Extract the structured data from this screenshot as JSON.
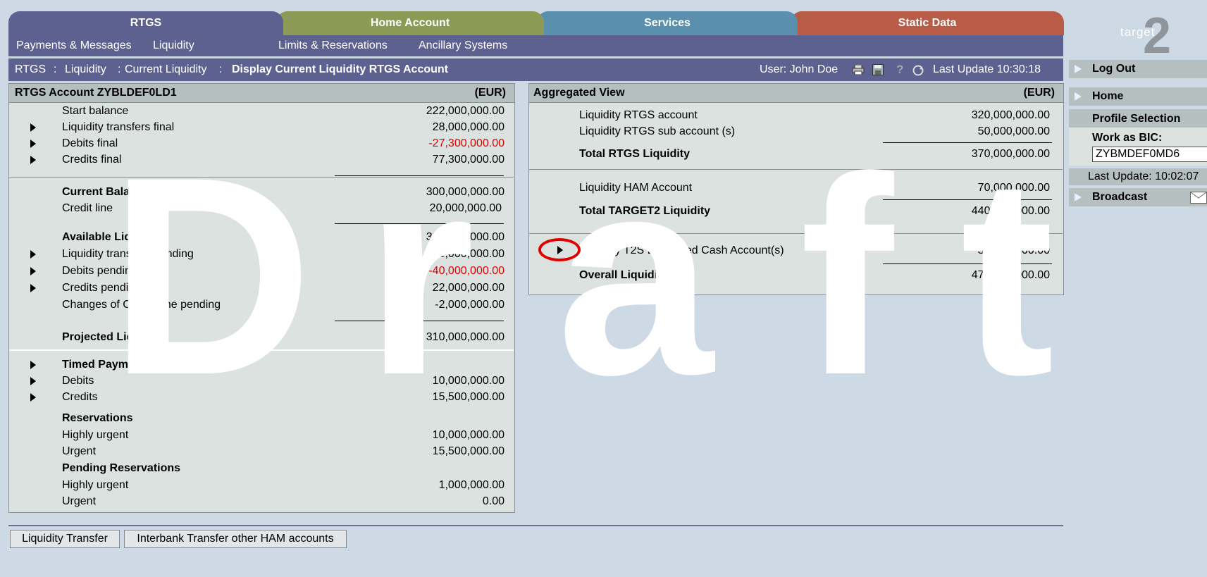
{
  "tabs": {
    "rtgs": "RTGS",
    "home": "Home Account",
    "services": "Services",
    "static": "Static Data"
  },
  "logo": {
    "text": "target",
    "digit": "2"
  },
  "subnav": {
    "payments": "Payments & Messages",
    "liquidity": "Liquidity",
    "limits": "Limits & Reservations",
    "ancillary": "Ancillary Systems"
  },
  "breadcrumb": {
    "c1": "RTGS",
    "c2": "Liquidity",
    "c3": "Current Liquidity",
    "sep": ":",
    "current": "Display Current Liquidity RTGS Account"
  },
  "header": {
    "user": "User: John Doe",
    "last_update": "Last Update 10:30:18"
  },
  "watermark": [
    "D",
    "r",
    "a",
    "f",
    "t"
  ],
  "left_panel": {
    "title": "RTGS Account ZYBLDEF0LD1",
    "currency": "(EUR)",
    "rows": [
      {
        "label": "Start balance",
        "value": "222,000,000.00"
      },
      {
        "label": "Liquidity transfers final",
        "value": "28,000,000.00"
      },
      {
        "label": "Debits final",
        "value": "-27,300,000.00"
      },
      {
        "label": "Credits final",
        "value": "77,300,000.00"
      },
      {
        "label": "Current Balance",
        "value": "300,000,000.00"
      },
      {
        "label": "Credit line",
        "value": "20,000,000.00"
      },
      {
        "label": "Available Liquidity",
        "value": "320,000,000.00"
      },
      {
        "label": "Liquidity transfers pending",
        "value": "10,000,000.00"
      },
      {
        "label": "Debits pending",
        "value": "-40,000,000.00"
      },
      {
        "label": "Credits pending",
        "value": "22,000,000.00"
      },
      {
        "label": "Changes of Credit Line pending",
        "value": "-2,000,000.00"
      },
      {
        "label": "Projected Liquidity",
        "value": "310,000,000.00"
      },
      {
        "label": "Timed Payments",
        "value": ""
      },
      {
        "label": "Debits",
        "value": "10,000,000.00"
      },
      {
        "label": "Credits",
        "value": "15,500,000.00"
      },
      {
        "label": "Reservations",
        "value": ""
      },
      {
        "label": "Highly urgent",
        "value": "10,000,000.00"
      },
      {
        "label": "Urgent",
        "value": "15,500,000.00"
      },
      {
        "label": "Pending Reservations",
        "value": ""
      },
      {
        "label": "Highly urgent",
        "value": "1,000,000.00"
      },
      {
        "label": "Urgent",
        "value": "0.00"
      }
    ]
  },
  "right_panel": {
    "title": "Aggregated View",
    "currency": "(EUR)",
    "rows": [
      {
        "label": "Liquidity RTGS account",
        "value": "320,000,000.00"
      },
      {
        "label": "Liquidity RTGS sub account (s)",
        "value": "50,000,000.00"
      },
      {
        "label": "Total RTGS Liquidity",
        "value": "370,000,000.00"
      },
      {
        "label": "Liquidity HAM Account",
        "value": "70,000,000.00"
      },
      {
        "label": "Total TARGET2 Liquidity",
        "value": "440,000,000.00"
      },
      {
        "label": "Liquidity T2S Dedicated Cash Account(s)",
        "value": "30,000,000.00"
      },
      {
        "label": "Overall Liquidity",
        "value": "470,000,000.00"
      }
    ]
  },
  "sidebar": {
    "logout": "Log Out",
    "home": "Home",
    "profile": "Profile Selection",
    "work_as": "Work as BIC:",
    "bic": "ZYBMDEF0MD6",
    "last_update": "Last Update: 10:02:07",
    "broadcast": "Broadcast"
  },
  "buttons": {
    "liquidity_transfer": "Liquidity Transfer",
    "interbank": "Interbank Transfer other HAM accounts"
  },
  "colors": {
    "accent": "#5c6190",
    "home": "#8c9a55",
    "services": "#5a90ad",
    "static": "#b85c47",
    "negative": "#e00000",
    "highlight": "#e00000"
  }
}
